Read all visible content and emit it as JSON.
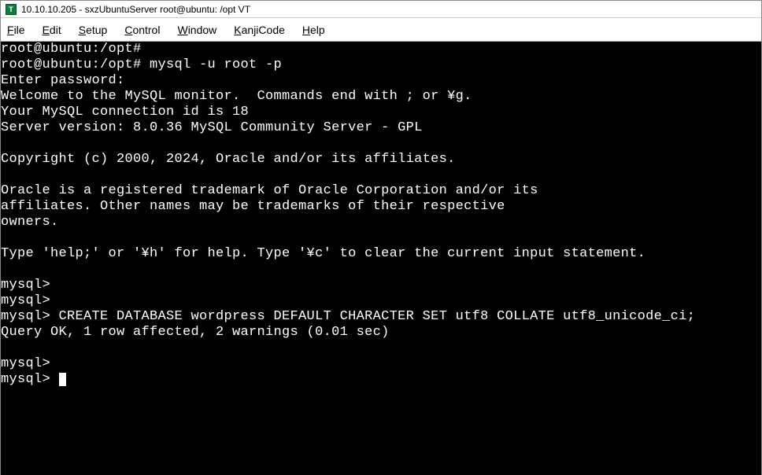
{
  "window": {
    "title": "10.10.10.205 - sxzUbuntuServer root@ubuntu: /opt VT",
    "icon_label": "T"
  },
  "menu": {
    "file": {
      "u": "F",
      "rest": "ile"
    },
    "edit": {
      "u": "E",
      "rest": "dit"
    },
    "setup": {
      "u": "S",
      "rest": "etup"
    },
    "control": {
      "u": "C",
      "rest": "ontrol"
    },
    "window": {
      "u": "W",
      "rest": "indow"
    },
    "kanji": {
      "u": "K",
      "rest": "anjiCode"
    },
    "help": {
      "u": "H",
      "rest": "elp"
    }
  },
  "term": {
    "l01": "root@ubuntu:/opt#",
    "l02": "root@ubuntu:/opt# mysql -u root -p",
    "l03": "Enter password:",
    "l04": "Welcome to the MySQL monitor.  Commands end with ; or ¥g.",
    "l05": "Your MySQL connection id is 18",
    "l06": "Server version: 8.0.36 MySQL Community Server - GPL",
    "l07": "",
    "l08": "Copyright (c) 2000, 2024, Oracle and/or its affiliates.",
    "l09": "",
    "l10": "Oracle is a registered trademark of Oracle Corporation and/or its",
    "l11": "affiliates. Other names may be trademarks of their respective",
    "l12": "owners.",
    "l13": "",
    "l14": "Type 'help;' or '¥h' for help. Type '¥c' to clear the current input statement.",
    "l15": "",
    "l16": "mysql>",
    "l17": "mysql>",
    "l18": "mysql> CREATE DATABASE wordpress DEFAULT CHARACTER SET utf8 COLLATE utf8_unicode_ci;",
    "l19": "Query OK, 1 row affected, 2 warnings (0.01 sec)",
    "l20": "",
    "l21": "mysql>",
    "l22": "mysql> "
  }
}
